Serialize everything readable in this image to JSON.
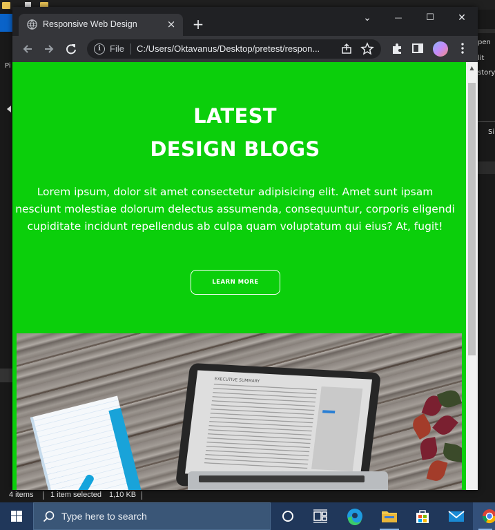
{
  "explorer": {
    "side_top": "pen",
    "side_mid": "lit",
    "side_bot": "story",
    "side_left": "Pi",
    "side_si": "Si",
    "status_items": "4 items",
    "status_selected": "1 item selected",
    "status_size": "1,10 KB"
  },
  "browser": {
    "tab_title": "Responsive Web Design",
    "close_tab_icon": "×",
    "new_tab_icon": "+",
    "omnibox_scheme": "File",
    "omnibox_url": "C:/Users/Oktavanus/Desktop/pretest/respon...",
    "window_controls": [
      "⌄",
      "—",
      "☐",
      "✕"
    ]
  },
  "page": {
    "title_line1": "LATEST",
    "title_line2": "DESIGN BLOGS",
    "body_text": "Lorem ipsum, dolor sit amet consectetur adipisicing elit. Amet sunt ipsam nesciunt molestiae dolorum delectus assumenda, consequuntur, corporis eligendi cupiditate incidunt repellendus ab culpa quam voluptatum qui eius? At, fugit!",
    "learn_more_label": "LEARN  MORE",
    "photo_doc_heading": "EXECUTIVE SUMMARY",
    "background_color": "#0bcf0b"
  },
  "taskbar": {
    "search_placeholder": "Type here to search"
  }
}
